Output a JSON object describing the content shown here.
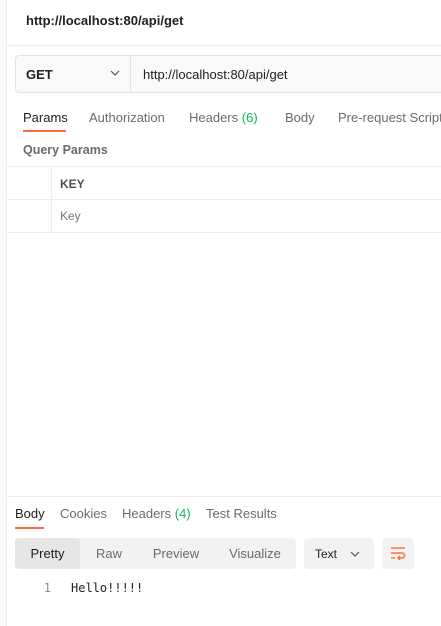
{
  "window": {
    "title": "http://localhost:80/api/get"
  },
  "request": {
    "method": "GET",
    "url": "http://localhost:80/api/get"
  },
  "request_tabs": [
    {
      "label": "Params",
      "count": ""
    },
    {
      "label": "Authorization",
      "count": ""
    },
    {
      "label": "Headers",
      "count": "(6)"
    },
    {
      "label": "Body",
      "count": ""
    },
    {
      "label": "Pre-request Script",
      "count": ""
    }
  ],
  "query_params": {
    "label": "Query Params",
    "column_key": "KEY",
    "key_placeholder": "Key"
  },
  "response_tabs": [
    {
      "label": "Body",
      "count": ""
    },
    {
      "label": "Cookies",
      "count": ""
    },
    {
      "label": "Headers",
      "count": "(4)"
    },
    {
      "label": "Test Results",
      "count": ""
    }
  ],
  "view_modes": [
    "Pretty",
    "Raw",
    "Preview",
    "Visualize"
  ],
  "format": "Text",
  "response_body": [
    {
      "line": "1",
      "text": "Hello!!!!!"
    }
  ],
  "colors": {
    "accent": "#ff6c37",
    "count_green": "#0cbb52",
    "text": "#212121",
    "muted": "#6b6b6b"
  },
  "icons": [
    "chevron-down-icon",
    "wrap-lines-icon"
  ]
}
